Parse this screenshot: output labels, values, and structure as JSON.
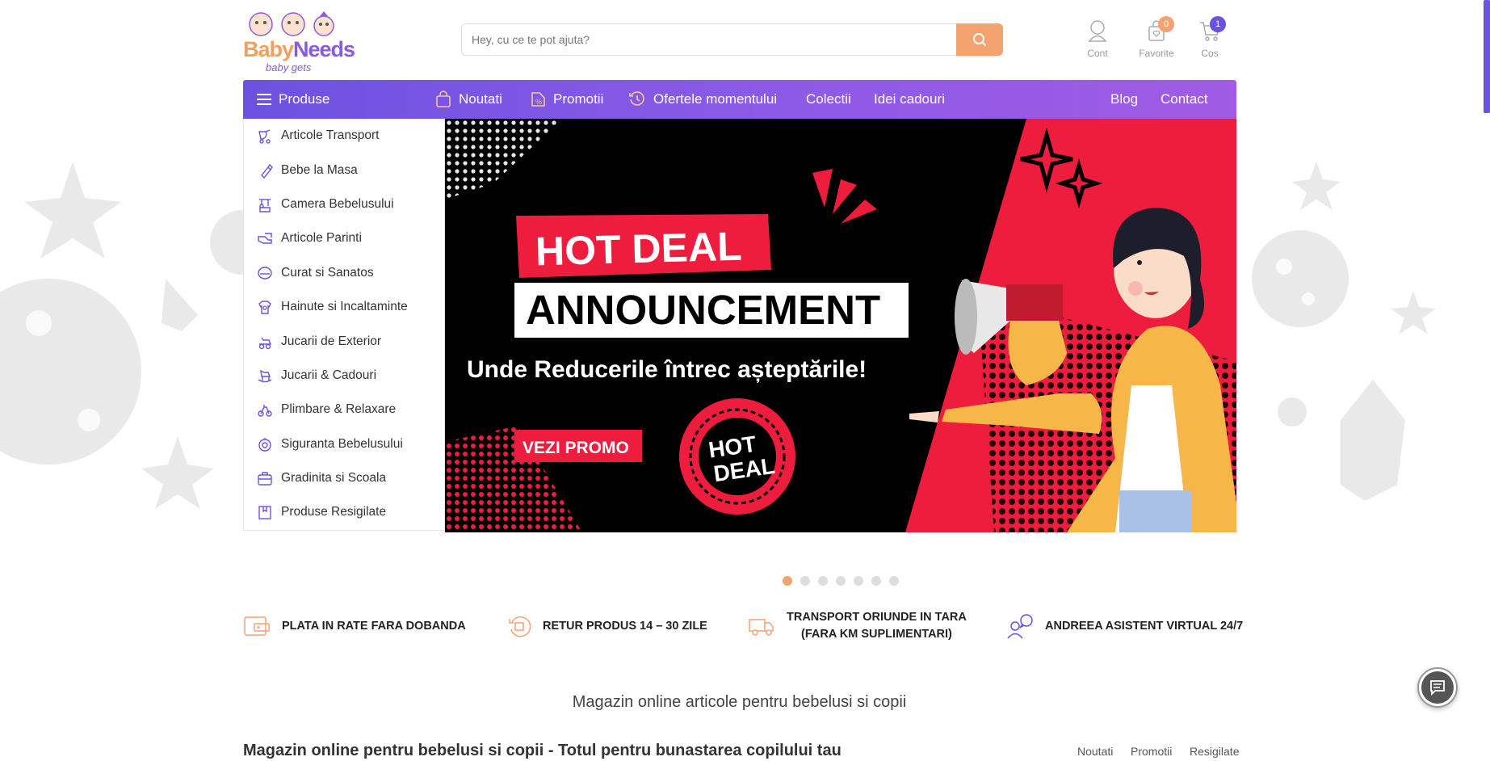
{
  "header": {
    "logo": {
      "brand_part1": "Baby",
      "brand_part2": "Needs",
      "subtitle": "baby gets"
    },
    "search": {
      "placeholder": "Hey, cu ce te pot ajuta?"
    },
    "account_label": "Cont",
    "favorites_label": "Favorite",
    "favorites_count": "0",
    "cart_label": "Cos",
    "cart_count": "1"
  },
  "nav": {
    "products_label": "Produse",
    "items": [
      {
        "label": "Noutati",
        "icon": "bag-icon"
      },
      {
        "label": "Promotii",
        "icon": "percent-tag-icon"
      },
      {
        "label": "Ofertele momentului",
        "icon": "history-clock-icon"
      },
      {
        "label": "Colectii"
      },
      {
        "label": "Idei cadouri"
      },
      {
        "label": "Blog"
      },
      {
        "label": "Contact"
      }
    ]
  },
  "categories": [
    {
      "label": "Articole Transport",
      "icon": "stroller-icon"
    },
    {
      "label": "Bebe la Masa",
      "icon": "baby-bottle-icon"
    },
    {
      "label": "Camera Bebelusului",
      "icon": "crib-mobile-icon"
    },
    {
      "label": "Articole Parinti",
      "icon": "parent-hands-icon"
    },
    {
      "label": "Curat si Sanatos",
      "icon": "bath-tub-icon"
    },
    {
      "label": "Hainute si Incaltaminte",
      "icon": "baby-clothes-icon"
    },
    {
      "label": "Jucarii de Exterior",
      "icon": "ride-on-toy-icon"
    },
    {
      "label": "Jucarii & Cadouri",
      "icon": "rocking-horse-icon"
    },
    {
      "label": "Plimbare & Relaxare",
      "icon": "tricycle-icon"
    },
    {
      "label": "Siguranta Bebelusului",
      "icon": "safety-icon"
    },
    {
      "label": "Gradinita si Scoala",
      "icon": "school-bag-icon"
    },
    {
      "label": "Produse Resigilate",
      "icon": "resealed-box-icon"
    }
  ],
  "banner": {
    "headline1": "HOT DEAL",
    "headline2": "ANNOUNCEMENT",
    "subline": "Unde Reducerile întrec așteptările!",
    "cta": "VEZI PROMO",
    "badge_line1": "HOT",
    "badge_line2": "DEAL",
    "colors": {
      "red": "#ee1c3d",
      "black": "#000000",
      "yellow": "#f6b748"
    }
  },
  "carousel": {
    "slide_count": 7,
    "active_index": 0
  },
  "features": [
    {
      "text": "PLATA IN RATE FARA DOBANDA",
      "icon": "card-wallet-icon"
    },
    {
      "text": "RETUR PRODUS 14 – 30 ZILE",
      "icon": "return-package-icon"
    },
    {
      "text_line1": "TRANSPORT ORIUNDE IN TARA",
      "text_line2": "(FARA KM SUPLIMENTARI)",
      "icon": "delivery-truck-icon"
    },
    {
      "text": "ANDREEA ASISTENT VIRTUAL 24/7",
      "icon": "virtual-assistant-icon"
    }
  ],
  "tagline": "Magazin online articole pentru bebelusi si copii",
  "section": {
    "title": "Magazin online pentru bebelusi si copii - Totul pentru bunastarea copilului tau",
    "links": [
      "Noutati",
      "Promotii",
      "Resigilate"
    ]
  },
  "colors": {
    "accent_orange": "#f5a271",
    "nav_purple": "#6c52e0",
    "nav_purple_end": "#a15be4",
    "badge_purple": "#6c52e0"
  }
}
